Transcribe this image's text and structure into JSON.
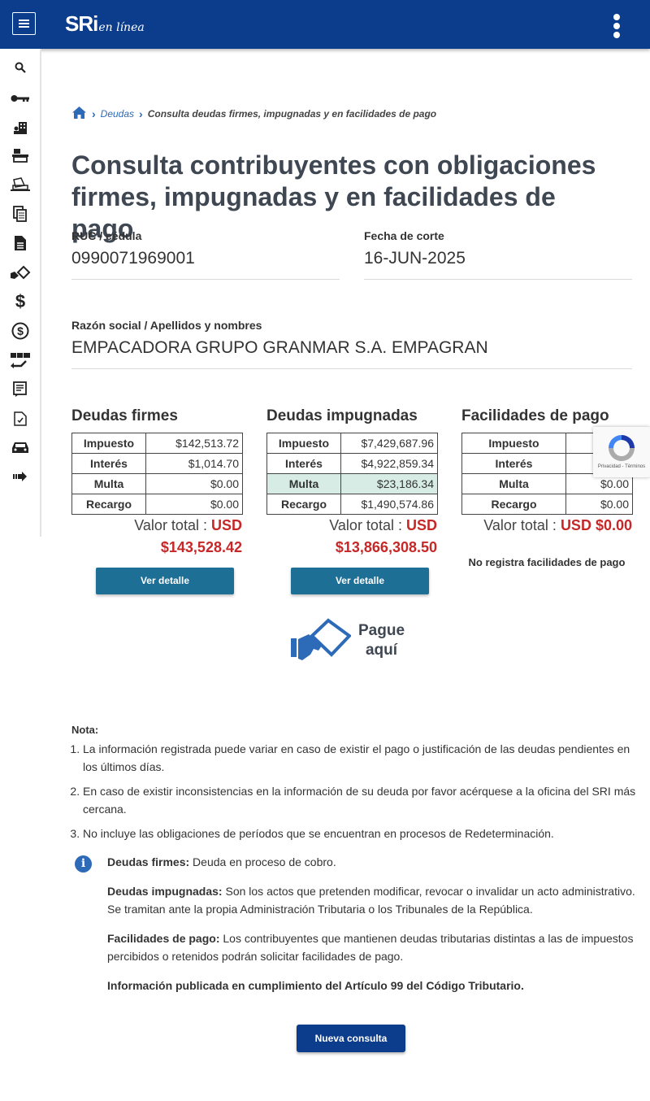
{
  "header": {
    "logo_main": "SRi",
    "logo_sub": "en línea",
    "menu_icon": "hamburger-icon",
    "more_icon": "kebab-icon",
    "bar_color": "#0c3c8c"
  },
  "sidebar": {
    "icons": [
      "search-icon",
      "key-icon",
      "building-icon",
      "register-icon",
      "laptop-icon",
      "documents-icon",
      "file-icon",
      "payment-icon",
      "dollar-icon",
      "dollar-circle-icon",
      "transfer-icon",
      "form-icon",
      "checklist-icon",
      "car-icon",
      "arrow-right-icon"
    ]
  },
  "breadcrumb": {
    "level1": "Deudas",
    "current": "Consulta deudas firmes, impugnadas y en facilidades de pago"
  },
  "page": {
    "title": "Consulta contribuyentes con obligaciones firmes, impugnadas y en facilidades de pago"
  },
  "fields": {
    "ruc_label": "RUC / cédula",
    "ruc_value": "0990071969001",
    "fecha_label": "Fecha de corte",
    "fecha_value": "16-JUN-2025",
    "razon_label": "Razón social / Apellidos y nombres",
    "razon_value": "EMPACADORA GRUPO GRANMAR S.A. EMPAGRAN"
  },
  "labels": {
    "impuesto": "Impuesto",
    "interes": "Interés",
    "multa": "Multa",
    "recargo": "Recargo",
    "valor_total": "Valor total :",
    "usd": "USD",
    "ver_detalle": "Ver detalle"
  },
  "firmes": {
    "title": "Deudas firmes",
    "impuesto": "$142,513.72",
    "interes": "$1,014.70",
    "multa": "$0.00",
    "recargo": "$0.00",
    "total": "$143,528.42"
  },
  "impugnadas": {
    "title": "Deudas impugnadas",
    "impuesto": "$7,429,687.96",
    "interes": "$4,922,859.34",
    "multa": "$23,186.34",
    "recargo": "$1,490,574.86",
    "total": "$13,866,308.50"
  },
  "facilidades": {
    "title": "Facilidades de pago",
    "multa": "$0.00",
    "recargo": "$0.00",
    "total_line": "USD $0.00",
    "no_registra": "No registra facilidades de pago"
  },
  "recaptcha": {
    "text": "Privacidad - Términos",
    "icon": "recaptcha-icon"
  },
  "pague": {
    "text1": "Pague",
    "text2": "aquí",
    "icon": "hand-card-icon"
  },
  "nota": {
    "title": "Nota:",
    "items": [
      "La información registrada puede variar en caso de existir el pago o justificación de las deudas pendientes en los últimos días.",
      "En caso de existir inconsistencias en la información de su deuda por favor acérquese a la oficina del SRI más cercana.",
      "No incluye las obligaciones de períodos que se encuentran en procesos de Redeterminación."
    ]
  },
  "defs": {
    "firmes_term": "Deudas firmes:",
    "firmes_text": " Deuda en proceso de cobro.",
    "impug_term": "Deudas impugnadas:",
    "impug_text": " Son los actos que pretenden modificar, revocar o invalidar un acto administrativo. Se tramitan ante la propia Administración Tributaria o los Tribunales de la República.",
    "fac_term": "Facilidades de pago:",
    "fac_text": " Los contribuyentes que mantienen deudas tributarias distintas a las de impuestos percibidos o retenidos podrán solicitar facilidades de pago.",
    "articulo": "Información publicada en cumplimiento del Artículo 99 del Código Tributario."
  },
  "actions": {
    "nueva_consulta": "Nueva consulta"
  }
}
